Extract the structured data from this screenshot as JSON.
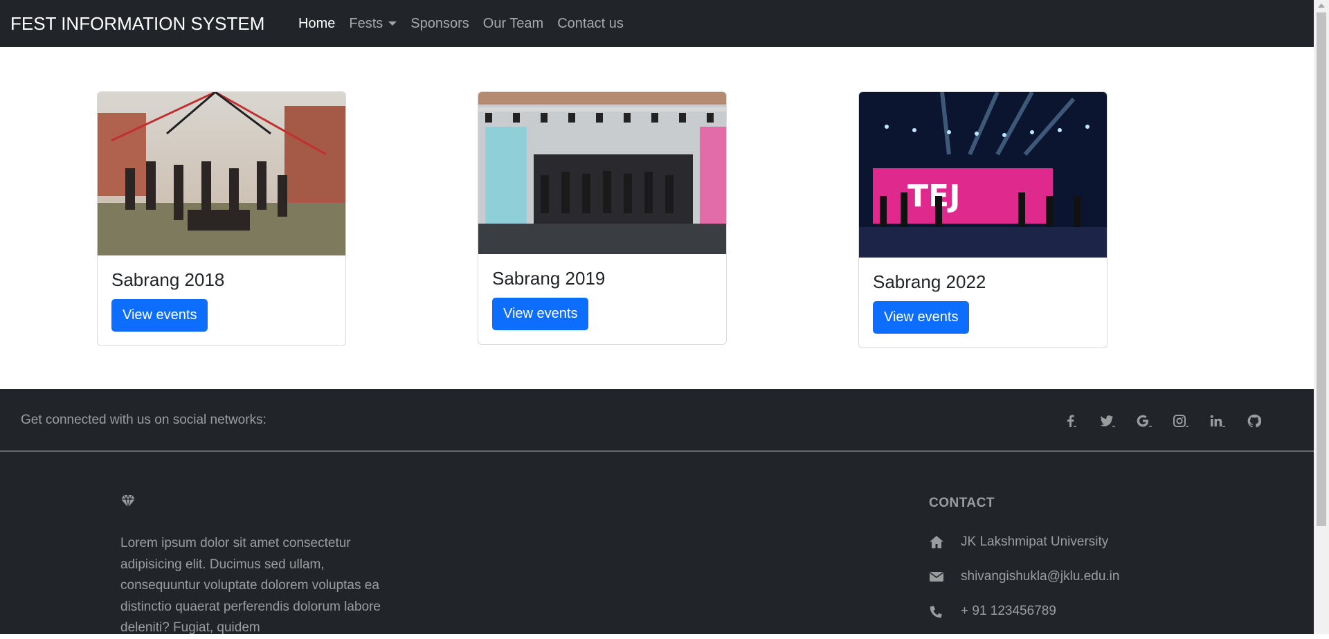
{
  "navbar": {
    "brand": "FEST INFORMATION SYSTEM",
    "links": [
      {
        "label": "Home",
        "active": true
      },
      {
        "label": "Fests",
        "dropdown": true
      },
      {
        "label": "Sponsors"
      },
      {
        "label": "Our Team"
      },
      {
        "label": "Contact us"
      }
    ]
  },
  "cards": [
    {
      "title": "Sabrang 2018",
      "button": "View events"
    },
    {
      "title": "Sabrang 2019",
      "button": "View events"
    },
    {
      "title": "Sabrang 2022",
      "button": "View events"
    }
  ],
  "footer": {
    "social_text": "Get connected with us on social networks:",
    "social_icons": [
      "facebook-icon",
      "twitter-icon",
      "google-icon",
      "instagram-icon",
      "linkedin-icon",
      "github-icon"
    ],
    "about_text": "Lorem ipsum dolor sit amet consectetur adipisicing elit. Ducimus sed ullam, consequuntur voluptate dolorem voluptas ea distinctio quaerat perferendis dolorum labore deleniti? Fugiat, quidem",
    "contact_heading": "CONTACT",
    "contact": {
      "address": "JK Lakshmipat University",
      "email": "shivangishukla@jklu.edu.in",
      "phone": "+ 91 123456789"
    }
  },
  "colors": {
    "navbar_bg": "#212529",
    "primary": "#0d6efd"
  }
}
